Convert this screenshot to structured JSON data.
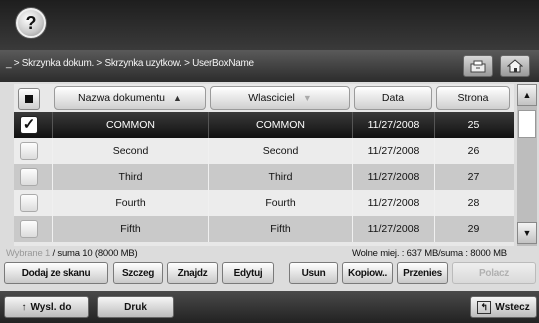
{
  "help": {
    "glyph": "?"
  },
  "path": {
    "text": "_ > Skrzynka dokum. > Skrzynka uzytkow. > UserBoxName"
  },
  "table": {
    "columns": [
      {
        "label": "Nazwa dokumentu",
        "sort": "▲"
      },
      {
        "label": "Wlasciciel",
        "sort": "▼"
      },
      {
        "label": "Data"
      },
      {
        "label": "Strona"
      }
    ],
    "rows": [
      {
        "name": "COMMON",
        "owner": "COMMON",
        "date": "11/27/2008",
        "pages": "25",
        "checked": "✓"
      },
      {
        "name": "Second",
        "owner": "Second",
        "date": "11/27/2008",
        "pages": "26"
      },
      {
        "name": "Third",
        "owner": "Third",
        "date": "11/27/2008",
        "pages": "27"
      },
      {
        "name": "Fourth",
        "owner": "Fourth",
        "date": "11/27/2008",
        "pages": "28"
      },
      {
        "name": "Fifth",
        "owner": "Fifth",
        "date": "11/27/2008",
        "pages": "29"
      }
    ]
  },
  "scroll": {
    "up": "▲",
    "down": "▼"
  },
  "status": {
    "selected_label": "Wybrane 1",
    "total": "/ suma 10 (8000 MB)",
    "free": "Wolne miej. : 637 MB/suma : 8000 MB"
  },
  "actions": {
    "add_scan": "Dodaj ze skanu",
    "details": "Szczeg",
    "find": "Znajdz",
    "edit": "Edytuj",
    "delete": "Usun",
    "copy": "Kopiow..",
    "move": "Przenies",
    "merge": "Polacz"
  },
  "bottom": {
    "send_arrow": "↑",
    "send": "Wysl. do",
    "print": "Druk",
    "back_glyph": "↰",
    "back": "Wstecz"
  }
}
